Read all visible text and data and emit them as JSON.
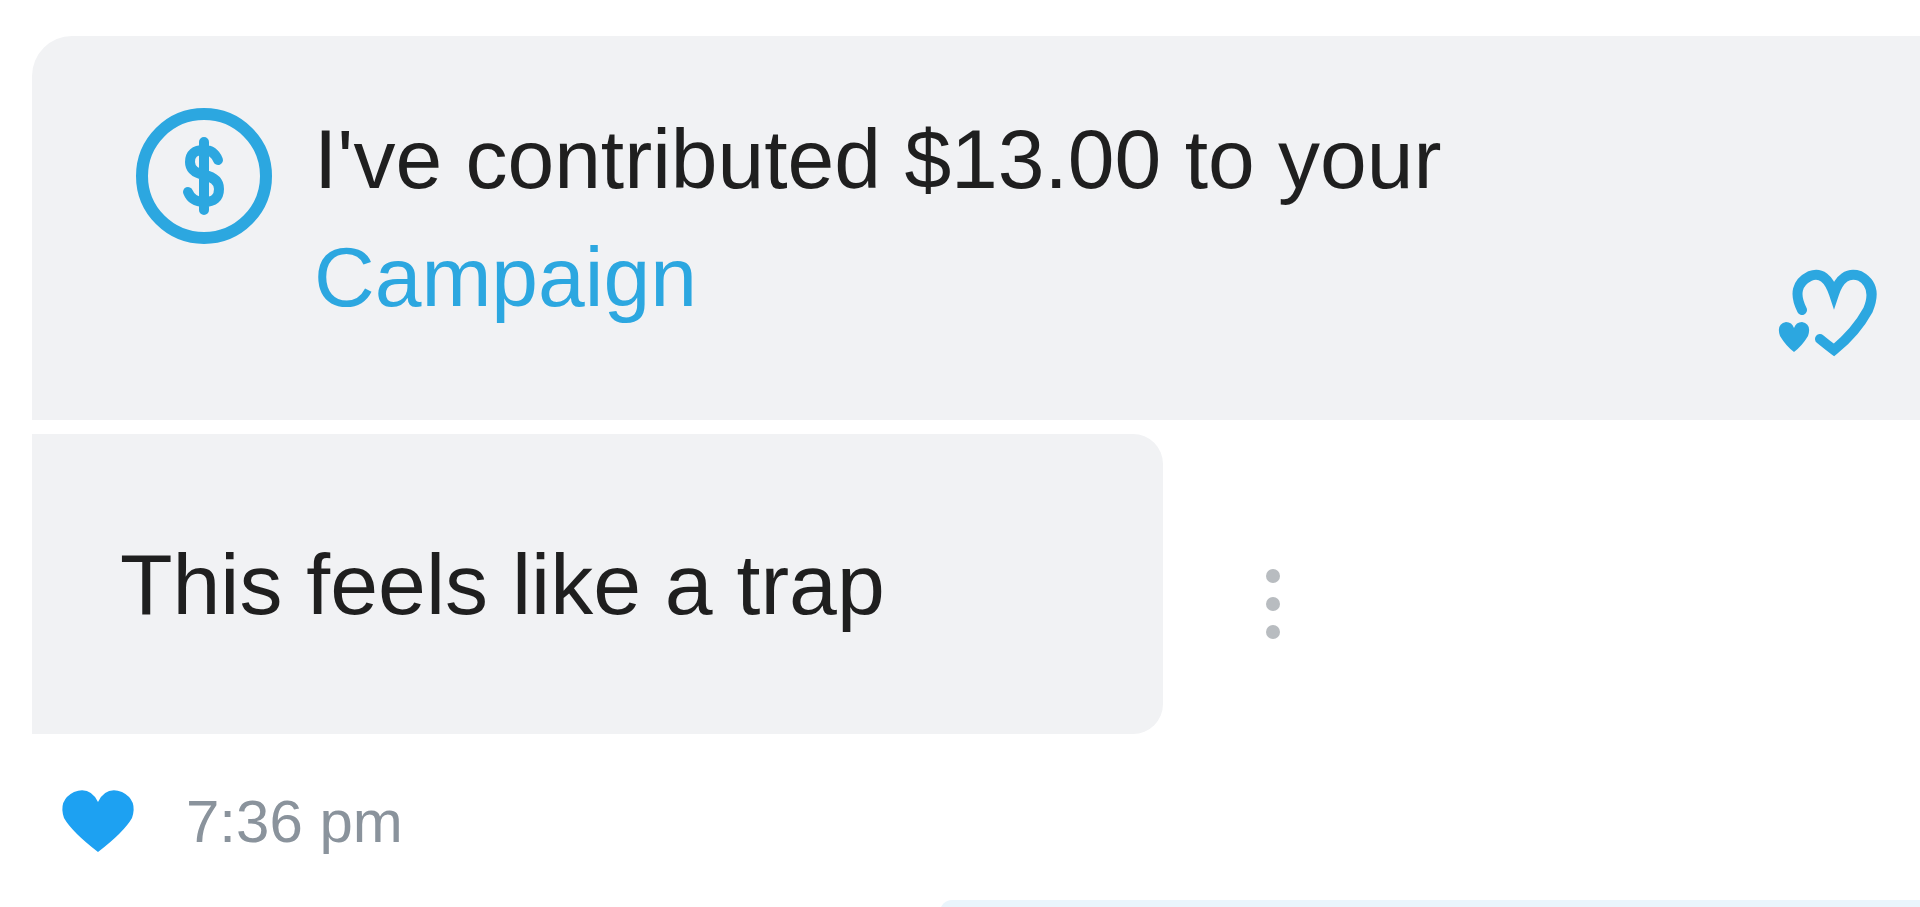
{
  "messages": [
    {
      "kind": "contribution",
      "text": "I've contributed $13.00 to your ",
      "link": "Campaign"
    },
    {
      "kind": "text",
      "text": "This feels like a trap",
      "liked": true,
      "time": "7:36 pm"
    }
  ]
}
